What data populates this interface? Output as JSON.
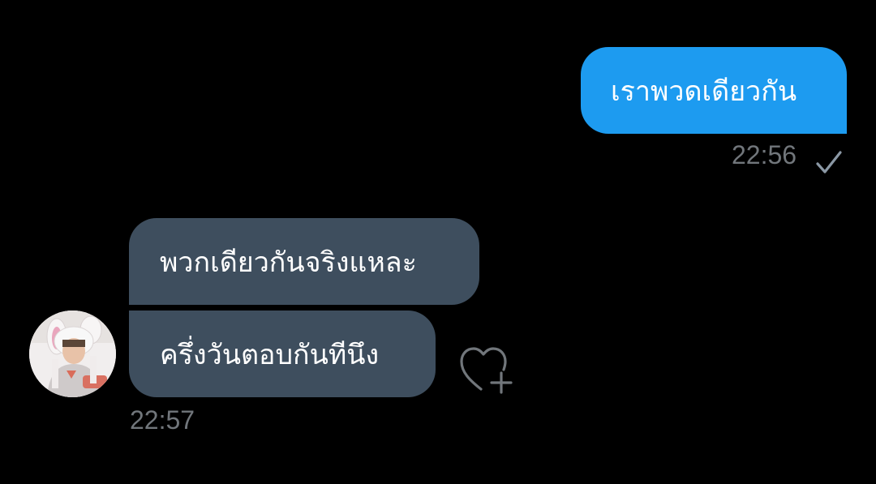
{
  "messages": {
    "outgoing": {
      "text": "เราพวดเดียวกัน",
      "time": "22:56",
      "status_icon": "checkmark-icon"
    },
    "incoming": {
      "bubble_1": "พวกเดียวกันจริงแหละ",
      "bubble_2": "ครึ่งวันตอบกันทีนึง",
      "time": "22:57",
      "reaction_icon": "heart-plus-icon"
    }
  },
  "colors": {
    "background": "#000000",
    "outgoing_bubble": "#1d9bf0",
    "incoming_bubble": "#3e4e5e",
    "meta_text": "#71767b"
  }
}
